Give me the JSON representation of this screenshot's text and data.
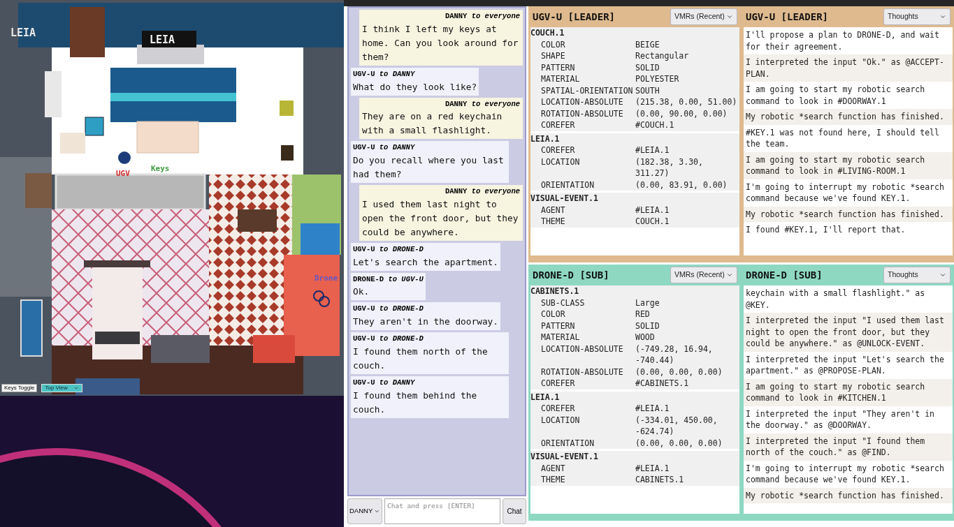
{
  "scene": {
    "wall_logo": "LEIA",
    "tv_logo": "LEIA",
    "labels": [
      {
        "text": "UGV",
        "color": "#d42b2b"
      },
      {
        "text": "Keys",
        "color": "#3f9a3f"
      },
      {
        "text": "Drone",
        "color": "#6656c8"
      }
    ],
    "keys_toggle": "Keys Toggle",
    "view_select": "Top View"
  },
  "chat": {
    "messages": [
      {
        "kind": "user",
        "header": "DANNY *to everyone*",
        "text": "I think I left my keys at home. Can you look around for them?"
      },
      {
        "kind": "agent",
        "header": "UGV-U *to DANNY*",
        "text": "What do they look like?"
      },
      {
        "kind": "user",
        "header": "DANNY *to everyone*",
        "text": "They are on a red keychain with a small flashlight."
      },
      {
        "kind": "agent",
        "header": "UGV-U *to DANNY*",
        "text": "Do you recall where you last had them?"
      },
      {
        "kind": "user",
        "header": "DANNY *to everyone*",
        "text": "I used them last night to open the front door, but they could be anywhere."
      },
      {
        "kind": "agent",
        "header": "UGV-U *to DRONE-D*",
        "text": "Let's search the apartment."
      },
      {
        "kind": "agent",
        "header": "DRONE-D *to UGV-U*",
        "text": "Ok."
      },
      {
        "kind": "agent",
        "header": "UGV-U *to DRONE-D*",
        "text": "They aren't in the doorway."
      },
      {
        "kind": "agent",
        "header": "UGV-U *to DRONE-D*",
        "text": "I found them north of the couch."
      },
      {
        "kind": "agent",
        "header": "UGV-U *to DANNY*",
        "text": "I found them behind the couch."
      }
    ],
    "sender_select": "DANNY",
    "input_placeholder": "Chat and press [ENTER]",
    "send_button": "Chat"
  },
  "agents": [
    {
      "color": "#dfba8e",
      "vmr": {
        "title": "UGV-U [LEADER]",
        "select": "VMRs (Recent)",
        "frames": [
          {
            "name": "COUCH.1",
            "slots": [
              {
                "key": "COLOR",
                "value": "BEIGE"
              },
              {
                "key": "SHAPE",
                "value": "Rectangular"
              },
              {
                "key": "PATTERN",
                "value": "SOLID"
              },
              {
                "key": "MATERIAL",
                "value": "POLYESTER"
              },
              {
                "key": "SPATIAL-ORIENTATION",
                "value": "SOUTH"
              },
              {
                "key": "LOCATION-ABSOLUTE",
                "value": "(215.38, 0.00, 51.00)"
              },
              {
                "key": "ROTATION-ABSOLUTE",
                "value": "(0.00, 90.00, 0.00)"
              },
              {
                "key": "COREFER",
                "value": "#COUCH.1"
              }
            ]
          },
          {
            "name": "LEIA.1",
            "slots": [
              {
                "key": "COREFER",
                "value": "#LEIA.1"
              },
              {
                "key": "LOCATION",
                "value": "(182.38, 3.30, 311.27)"
              },
              {
                "key": "ORIENTATION",
                "value": "(0.00, 83.91, 0.00)"
              }
            ]
          },
          {
            "name": "VISUAL-EVENT.1",
            "slots": [
              {
                "key": "AGENT",
                "value": "#LEIA.1"
              },
              {
                "key": "THEME",
                "value": "COUCH.1"
              }
            ]
          }
        ]
      },
      "thoughts": {
        "title": "UGV-U [LEADER]",
        "select": "Thoughts",
        "items": [
          "I'll propose a plan to DRONE-D, and wait for their agreement.",
          "I interpreted the input \"Ok.\" as @ACCEPT-PLAN.",
          "I am going to start my robotic search command to look in #DOORWAY.1",
          "My robotic *search function has finished.",
          "#KEY.1 was not found here, I should tell the team.",
          "I am going to start my robotic search command to look in #LIVING-ROOM.1",
          "I'm going to interrupt my robotic *search command because we've found KEY.1.",
          "My robotic *search function has finished.",
          "I found #KEY.1, I'll report that."
        ]
      }
    },
    {
      "color": "#8ed8c2",
      "vmr": {
        "title": "DRONE-D [SUB]",
        "select": "VMRs (Recent)",
        "frames": [
          {
            "name": "CABINETS.1",
            "slots": [
              {
                "key": "SUB-CLASS",
                "value": "Large"
              },
              {
                "key": "COLOR",
                "value": "RED"
              },
              {
                "key": "PATTERN",
                "value": "SOLID"
              },
              {
                "key": "MATERIAL",
                "value": "WOOD"
              },
              {
                "key": "LOCATION-ABSOLUTE",
                "value": "(-749.28, 16.94, -740.44)"
              },
              {
                "key": "ROTATION-ABSOLUTE",
                "value": "(0.00, 0.00, 0.00)"
              },
              {
                "key": "COREFER",
                "value": "#CABINETS.1"
              }
            ]
          },
          {
            "name": "LEIA.1",
            "slots": [
              {
                "key": "COREFER",
                "value": "#LEIA.1"
              },
              {
                "key": "LOCATION",
                "value": "(-334.01, 450.00, -624.74)"
              },
              {
                "key": "ORIENTATION",
                "value": "(0.00, 0.00, 0.00)"
              }
            ]
          },
          {
            "name": "VISUAL-EVENT.1",
            "slots": [
              {
                "key": "AGENT",
                "value": "#LEIA.1"
              },
              {
                "key": "THEME",
                "value": "CABINETS.1"
              }
            ]
          }
        ]
      },
      "thoughts": {
        "title": "DRONE-D [SUB]",
        "select": "Thoughts",
        "items": [
          "keychain with a small flashlight.\" as @KEY.",
          "I interpreted the input \"I used them last night to open the front door, but they could be anywhere.\" as @UNLOCK-EVENT.",
          "I interpreted the input \"Let's search the apartment.\" as @PROPOSE-PLAN.",
          "I am going to start my robotic search command to look in #KITCHEN.1",
          "I interpreted the input \"They aren't in the doorway.\" as @DOORWAY.",
          "I interpreted the input \"I found them north of the couch.\" as @FIND.",
          "I'm going to interrupt my robotic *search command because we've found KEY.1.",
          "My robotic *search function has finished."
        ]
      }
    }
  ]
}
